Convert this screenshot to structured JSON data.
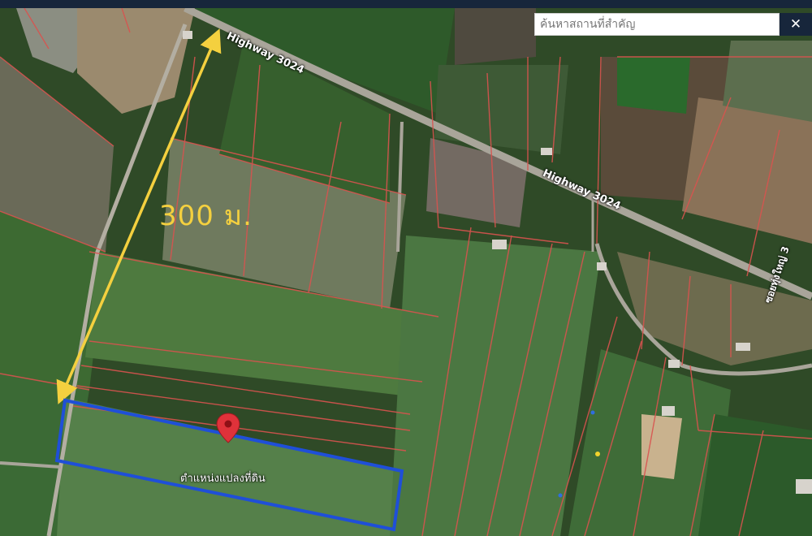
{
  "search": {
    "placeholder": "ค้นหาสถานที่สำคัญ",
    "close_label": "✕"
  },
  "map": {
    "distance_label": "300 ม.",
    "road_labels": [
      "Highway 3024",
      "Highway 3024",
      "ซอยทุ่งใหญ่ 3"
    ],
    "pin_label": "ตำแหน่งแปลงที่ดิน",
    "colors": {
      "parcel_lines": "#d9534f",
      "measure_arrow": "#f4d03f",
      "plot_outline": "#1f4fd8",
      "pin": "#e0323a"
    }
  }
}
